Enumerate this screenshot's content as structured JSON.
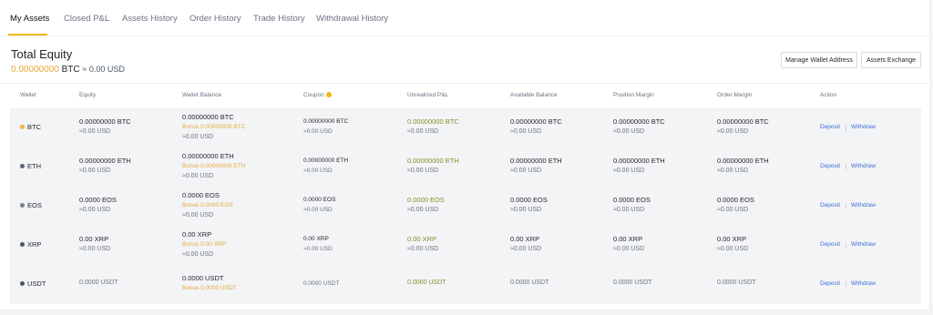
{
  "tabs": [
    "My Assets",
    "Closed P&L",
    "Assets History",
    "Order History",
    "Trade History",
    "Withdrawal History"
  ],
  "summary": {
    "title": "Total Equity",
    "btc_value": "0.00000000",
    "btc_unit": "BTC",
    "usd_value": "≈ 0.00 USD",
    "manage_label": "Manage Wallet Address",
    "exchange_label": "Assets Exchange"
  },
  "colors": {
    "accent": "#f0b90b",
    "link": "#3b6fd4",
    "green": "#8a8d2c"
  },
  "table": {
    "headers": [
      "Wallet",
      "Equity",
      "Wallet Balance",
      "Coupon",
      "Unrealized P&L",
      "Available Balance",
      "Position Margin",
      "Order Margin",
      "Action"
    ],
    "deposit_label": "Deposit",
    "withdraw_label": "Withdraw",
    "rows": [
      {
        "coin": "BTC",
        "dot_color": "#f0b43c",
        "equity": "0.00000000 BTC",
        "equity_usd": "≈0.00 USD",
        "wallet": "0.00000000 BTC",
        "wallet_bonus": "Bonus 0.00000000 BTC",
        "wallet_usd": "≈0.00 USD",
        "coupon": "0.00000000 BTC",
        "coupon_usd": "≈0.00 USD",
        "pnl": "0.00000000 BTC",
        "pnl_usd": "≈0.00 USD",
        "available": "0.00000000 BTC",
        "available_usd": "≈0.00 USD",
        "position": "0.00000000 BTC",
        "position_usd": "≈0.00 USD",
        "order": "0.00000000 BTC",
        "order_usd": "≈0.00 USD"
      },
      {
        "coin": "ETH",
        "dot_color": "#5a6478",
        "equity": "0.00000000 ETH",
        "equity_usd": "≈0.00 USD",
        "wallet": "0.00000000 ETH",
        "wallet_bonus": "Bonus 0.00000000 ETH",
        "wallet_usd": "≈0.00 USD",
        "coupon": "0.00000000 ETH",
        "coupon_usd": "≈0.00 USD",
        "pnl": "0.00000000 ETH",
        "pnl_usd": "≈0.00 USD",
        "available": "0.00000000 ETH",
        "available_usd": "≈0.00 USD",
        "position": "0.00000000 ETH",
        "position_usd": "≈0.00 USD",
        "order": "0.00000000 ETH",
        "order_usd": "≈0.00 USD"
      },
      {
        "coin": "EOS",
        "dot_color": "#7a7f88",
        "equity": "0.0000 EOS",
        "equity_usd": "≈0.00 USD",
        "wallet": "0.0000 EOS",
        "wallet_bonus": "Bonus 0.0000 EOS",
        "wallet_usd": "≈0.00 USD",
        "coupon": "0.0000 EOS",
        "coupon_usd": "≈0.00 USD",
        "pnl": "0.0000 EOS",
        "pnl_usd": "≈0.00 USD",
        "available": "0.0000 EOS",
        "available_usd": "≈0.00 USD",
        "position": "0.0000 EOS",
        "position_usd": "≈0.00 USD",
        "order": "0.0000 EOS",
        "order_usd": "≈0.00 USD"
      },
      {
        "coin": "XRP",
        "dot_color": "#4e5466",
        "equity": "0.00 XRP",
        "equity_usd": "≈0.00 USD",
        "wallet": "0.00 XRP",
        "wallet_bonus": "Bonus 0.00 XRP",
        "wallet_usd": "≈0.00 USD",
        "coupon": "0.00 XRP",
        "coupon_usd": "≈0.00 USD",
        "pnl": "0.00 XRP",
        "pnl_usd": "≈0.00 USD",
        "available": "0.00 XRP",
        "available_usd": "≈0.00 USD",
        "position": "0.00 XRP",
        "position_usd": "≈0.00 USD",
        "order": "0.00 XRP",
        "order_usd": "≈0.00 USD"
      },
      {
        "coin": "USDT",
        "dot_color": "#4e5466",
        "equity": "0.0000 USDT",
        "wallet": "0.0000 USDT",
        "wallet_bonus": "Bonus 0.0000 USDT",
        "coupon": "0.0000 USDT",
        "pnl": "0.0000 USDT",
        "available": "0.0000 USDT",
        "position": "0.0000 USDT",
        "order": "0.0000 USDT"
      }
    ]
  }
}
